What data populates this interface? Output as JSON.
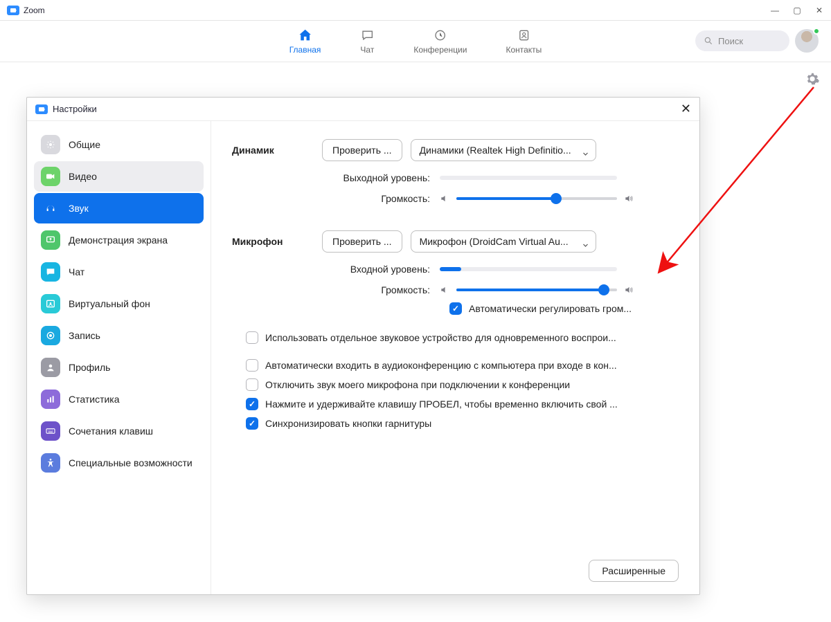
{
  "window": {
    "title": "Zoom"
  },
  "tabs": {
    "home": "Главная",
    "chat": "Чат",
    "meetings": "Конференции",
    "contacts": "Контакты"
  },
  "search": {
    "placeholder": "Поиск"
  },
  "settings": {
    "title": "Настройки",
    "side": {
      "general": "Общие",
      "video": "Видео",
      "audio": "Звук",
      "share": "Демонстрация экрана",
      "chat": "Чат",
      "bg": "Виртуальный фон",
      "record": "Запись",
      "profile": "Профиль",
      "stats": "Статистика",
      "keys": "Сочетания клавиш",
      "access": "Специальные возможности"
    },
    "audio": {
      "speaker_label": "Динамик",
      "test_btn": "Проверить ...",
      "speaker_device": "Динамики (Realtek High Definitio...",
      "output_level": "Выходной уровень:",
      "volume": "Громкость:",
      "speaker_volume_pct": 62,
      "mic_label": "Микрофон",
      "mic_device": "Микрофон (DroidCam Virtual Au...",
      "input_level": "Входной уровень:",
      "input_level_pct": 12,
      "mic_volume_pct": 92,
      "auto_gain": "Автоматически регулировать гром...",
      "auto_gain_checked": true,
      "opts": [
        {
          "label": "Использовать отдельное звуковое устройство для одновременного воспрои...",
          "checked": false
        },
        {
          "label": "Автоматически входить в аудиоконференцию с компьютера при входе в кон...",
          "checked": false
        },
        {
          "label": "Отключить звук моего микрофона при подключении к конференции",
          "checked": false
        },
        {
          "label": "Нажмите и удерживайте клавишу ПРОБЕЛ, чтобы временно включить свой ...",
          "checked": true
        },
        {
          "label": "Синхронизировать кнопки гарнитуры",
          "checked": true
        }
      ],
      "advanced_btn": "Расширенные"
    }
  }
}
